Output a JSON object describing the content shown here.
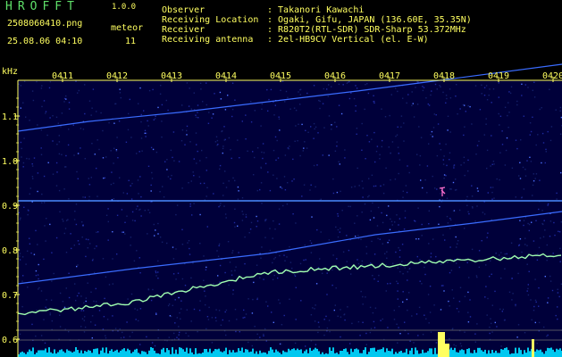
{
  "header": {
    "app_name": "HROFFT",
    "version": "1.0.0",
    "filename": "2508060410.png",
    "timestamp": "25.08.06 04:10",
    "meteor_label": "meteor",
    "meteor_count": "11",
    "info": [
      {
        "label": "Observer",
        "value": ": Takanori Kawachi"
      },
      {
        "label": "Receiving Location",
        "value": ": Ogaki, Gifu, JAPAN (136.60E, 35.35N)"
      },
      {
        "label": "Receiver",
        "value": ": R820T2(RTL-SDR) SDR-Sharp 53.372MHz"
      },
      {
        "label": "Receiving antenna",
        "value": ": 2el-HB9CV Vertical (el. E-W)"
      }
    ]
  },
  "axes": {
    "y_unit": "kHz",
    "y_ticks": [
      "1.1",
      "1.0",
      "0.9",
      "0.8",
      "0.7",
      "0.6"
    ],
    "x_ticks": [
      "0411",
      "0412",
      "0413",
      "0414",
      "0415",
      "0416",
      "0417",
      "0418",
      "0419",
      "0420"
    ]
  },
  "colors": {
    "background": "#000000",
    "plot_bg": "#00003a",
    "axis_text": "#ffff60",
    "header_text": "#5fe06a",
    "trace": "#3a6cff",
    "trace_bright": "#a0ffb0",
    "meteor_burst": "#ffff60",
    "noise_floor": "#00c8f0"
  }
}
